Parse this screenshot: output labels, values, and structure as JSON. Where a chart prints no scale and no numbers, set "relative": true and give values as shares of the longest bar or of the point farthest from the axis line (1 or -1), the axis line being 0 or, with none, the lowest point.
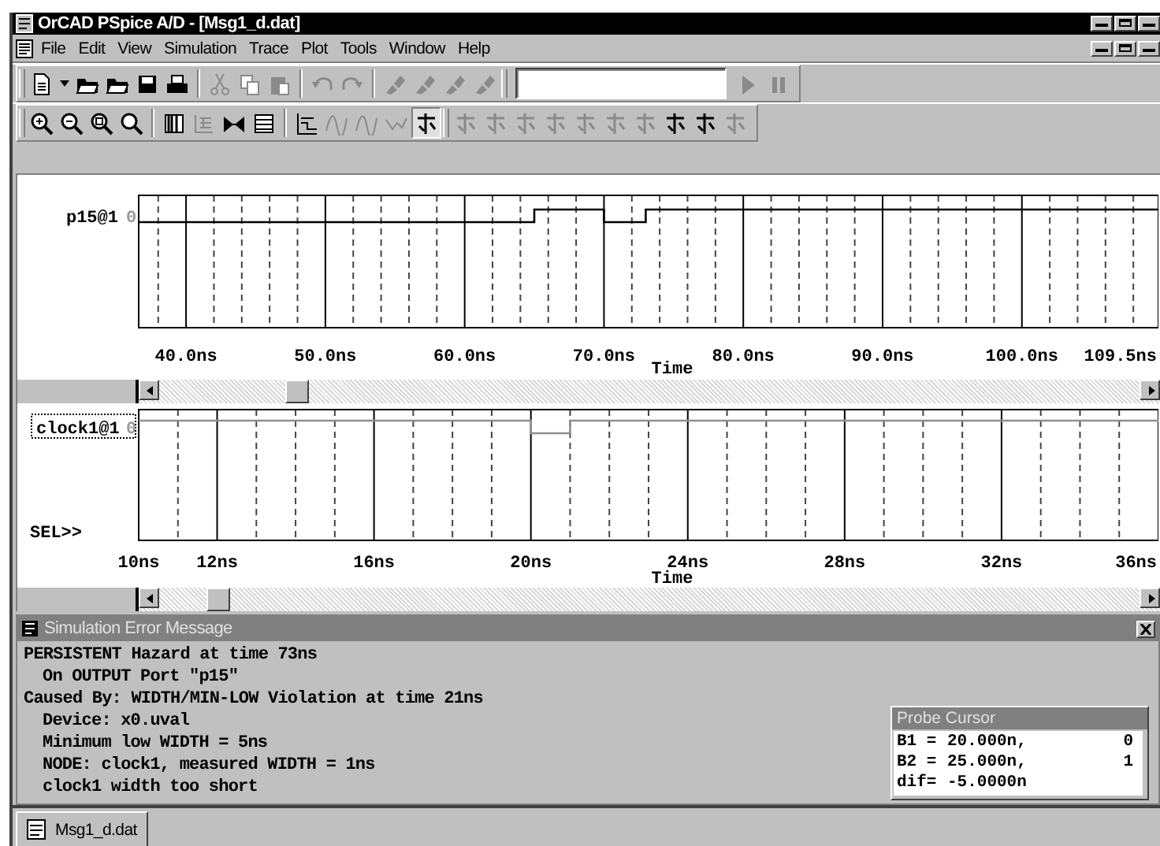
{
  "window": {
    "title": "OrCAD PSpice A/D  - [Msg1_d.dat]"
  },
  "menu": [
    "File",
    "Edit",
    "View",
    "Simulation",
    "Trace",
    "Plot",
    "Tools",
    "Window",
    "Help"
  ],
  "toolbars": [
    {
      "groups": [
        {
          "buttons": [
            {
              "kind": "new",
              "disabled": false
            },
            {
              "kind": "dropdown",
              "disabled": false
            },
            {
              "kind": "open",
              "disabled": false
            },
            {
              "kind": "open",
              "disabled": false
            },
            {
              "kind": "save",
              "disabled": false
            },
            {
              "kind": "print",
              "disabled": false
            }
          ]
        },
        {
          "buttons": [
            {
              "kind": "cut",
              "disabled": true
            },
            {
              "kind": "copy",
              "disabled": true
            },
            {
              "kind": "paste",
              "disabled": true
            }
          ]
        },
        {
          "buttons": [
            {
              "kind": "undo",
              "disabled": true
            },
            {
              "kind": "redo",
              "disabled": true
            }
          ]
        },
        {
          "buttons": [
            {
              "kind": "marker",
              "disabled": true
            },
            {
              "kind": "marker",
              "disabled": true
            },
            {
              "kind": "marker",
              "disabled": true
            },
            {
              "kind": "marker",
              "disabled": true
            }
          ]
        },
        {
          "buttons": [
            {
              "kind": "field",
              "disabled": false
            },
            {
              "kind": "run",
              "disabled": true
            },
            {
              "kind": "pause",
              "disabled": true
            }
          ]
        }
      ]
    },
    {
      "groups": [
        {
          "buttons": [
            {
              "kind": "zoom-in",
              "disabled": false
            },
            {
              "kind": "zoom-out",
              "disabled": false
            },
            {
              "kind": "zoom-area",
              "disabled": false
            },
            {
              "kind": "zoom-fit",
              "disabled": false
            }
          ]
        },
        {
          "buttons": [
            {
              "kind": "columns",
              "disabled": false
            },
            {
              "kind": "grid",
              "disabled": true
            },
            {
              "kind": "scissors",
              "disabled": false
            },
            {
              "kind": "table",
              "disabled": false
            }
          ]
        },
        {
          "buttons": [
            {
              "kind": "graph",
              "disabled": false,
              "pressed": false
            },
            {
              "kind": "curve",
              "disabled": true,
              "pressed": false
            },
            {
              "kind": "curve",
              "disabled": true,
              "pressed": false
            },
            {
              "kind": "wave",
              "disabled": true,
              "pressed": false
            },
            {
              "kind": "cursor",
              "disabled": false,
              "pressed": true
            }
          ]
        },
        {
          "buttons": [
            {
              "kind": "cursor",
              "disabled": true
            },
            {
              "kind": "cursor",
              "disabled": true
            },
            {
              "kind": "cursor",
              "disabled": true
            },
            {
              "kind": "cursor",
              "disabled": true
            },
            {
              "kind": "cursor",
              "disabled": true
            },
            {
              "kind": "cursor",
              "disabled": true
            },
            {
              "kind": "cursor",
              "disabled": true
            },
            {
              "kind": "cursor",
              "disabled": false
            },
            {
              "kind": "cursor",
              "disabled": false
            },
            {
              "kind": "cursor",
              "disabled": true
            }
          ]
        }
      ]
    }
  ],
  "plots": [
    {
      "signal_value": "0",
      "selected": false,
      "chart_data": {
        "type": "line",
        "relative": true,
        "grid": true,
        "xlabel": "Time",
        "xlim": [
          36.6,
          109.8
        ],
        "xticks": [
          {
            "value": 40,
            "label": "40.0ns"
          },
          {
            "value": 50,
            "label": "50.0ns"
          },
          {
            "value": 60,
            "label": "60.0ns"
          },
          {
            "value": 70,
            "label": "70.0ns"
          },
          {
            "value": 80,
            "label": "80.0ns"
          },
          {
            "value": 90,
            "label": "90.0ns"
          },
          {
            "value": 100,
            "label": "100.0ns"
          },
          {
            "value": 109.5,
            "label": "109.5ns"
          }
        ],
        "x": [
          36.6,
          65,
          65,
          70,
          70,
          73,
          73,
          109.8
        ],
        "series": [
          {
            "name": "p15@1",
            "color": "#000000",
            "values": [
              0,
              0,
              1,
              1,
              0,
              0,
              1,
              1
            ]
          }
        ]
      }
    },
    {
      "signal_value": "0",
      "selected": true,
      "marker": "SEL>>",
      "chart_data": {
        "type": "line",
        "relative": true,
        "grid": true,
        "xlabel": "Time",
        "xlim": [
          10,
          36
        ],
        "xticks": [
          {
            "value": 10,
            "label": "10ns"
          },
          {
            "value": 12,
            "label": "12ns"
          },
          {
            "value": 16,
            "label": "16ns"
          },
          {
            "value": 20,
            "label": "20ns"
          },
          {
            "value": 24,
            "label": "24ns"
          },
          {
            "value": 28,
            "label": "28ns"
          },
          {
            "value": 32,
            "label": "32ns"
          },
          {
            "value": 36,
            "label": "36ns"
          }
        ],
        "x": [
          10,
          20,
          20,
          21,
          21,
          36
        ],
        "series": [
          {
            "name": "clock1@1",
            "color": "#909090",
            "values": [
              1,
              1,
              0,
              0,
              1,
              1
            ]
          }
        ]
      }
    }
  ],
  "error_window": {
    "title": "Simulation Error Message",
    "lines": [
      {
        "text": "PERSISTENT Hazard at time 73ns",
        "indented": false
      },
      {
        "text": "On OUTPUT Port \"p15\"",
        "indented": true
      },
      {
        "text": "Caused By: WIDTH/MIN-LOW Violation at time 21ns",
        "indented": false
      },
      {
        "text": "Device: x0.uval",
        "indented": true
      },
      {
        "text": "Minimum low WIDTH = 5ns",
        "indented": true
      },
      {
        "text": "NODE: clock1, measured WIDTH = 1ns",
        "indented": true
      },
      {
        "text": "clock1 width too short",
        "indented": true
      }
    ]
  },
  "probe_cursor": {
    "title": "Probe Cursor",
    "rows": [
      {
        "label": "B1 =",
        "value": "20.000n,",
        "state": "0"
      },
      {
        "label": "B2 =",
        "value": "25.000n,",
        "state": "1"
      },
      {
        "label": "dif=",
        "value": "-5.0000n"
      }
    ]
  },
  "taskbar": [
    {
      "label": "Msg1_d.dat"
    }
  ]
}
